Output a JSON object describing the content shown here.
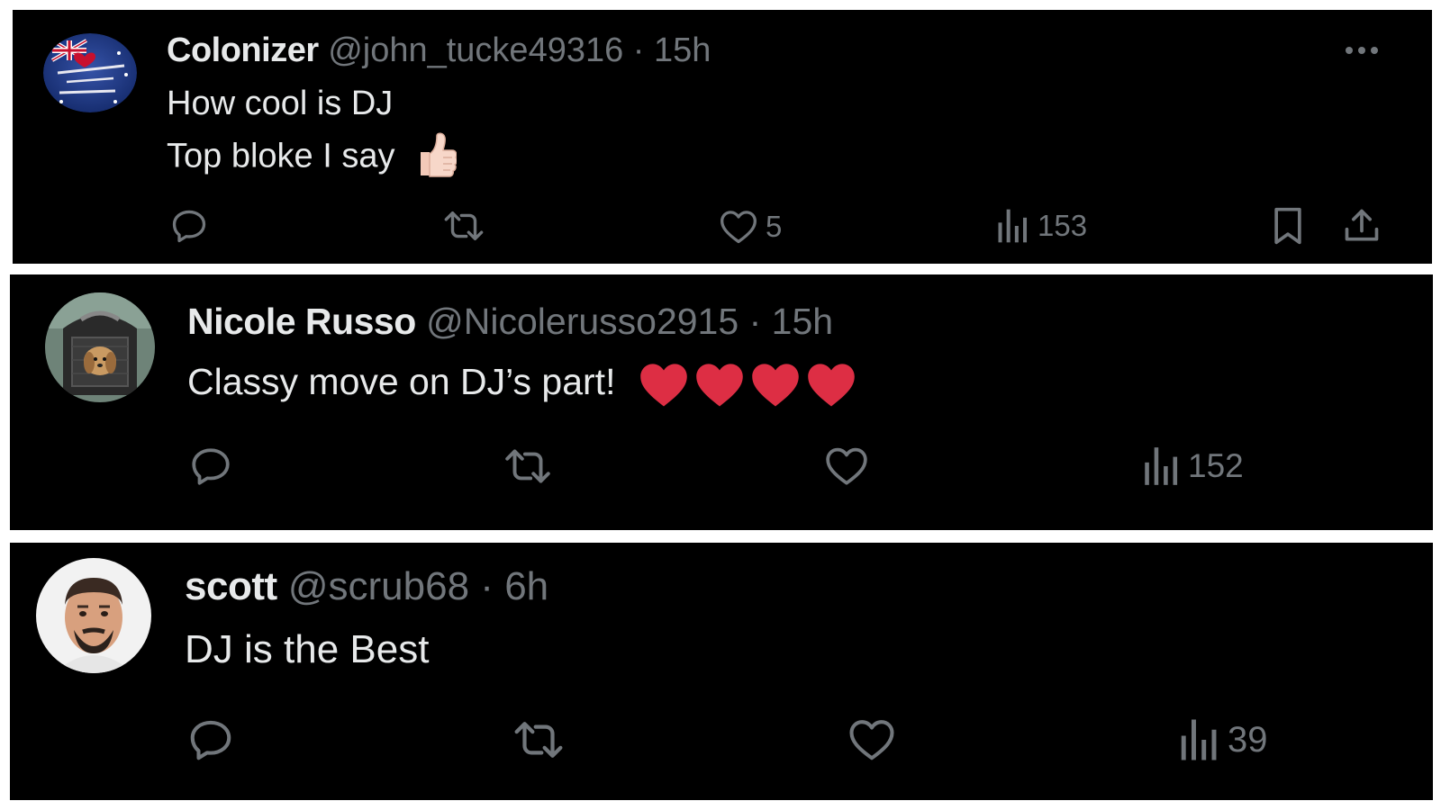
{
  "posts": [
    {
      "name": "Colonizer",
      "handle": "@john_tucke49316",
      "separator": "·",
      "time": "15h",
      "lines": [
        "How cool is DJ",
        "Top bloke I say"
      ],
      "emoji": "thumbs-up",
      "likes": "5",
      "views": "153",
      "avatar": {
        "colors": [
          "#1d3a8a",
          "#c8102e",
          "#ffffff"
        ],
        "lettering": "Happy Australia Day January 26th"
      }
    },
    {
      "name": "Nicole Russo",
      "handle": "@Nicolerusso2915",
      "separator": "·",
      "time": "15h",
      "text": "Classy move on DJ’s part!",
      "emoji": "red-heart x4",
      "views": "152"
    },
    {
      "name": "scott",
      "handle": "@scrub68",
      "separator": "·",
      "time": "6h",
      "text": "DJ is the Best",
      "views": "39"
    }
  ],
  "icons": {
    "reply": "speech-bubble",
    "repost": "repost-arrows",
    "like": "heart-outline",
    "views": "bar-chart",
    "bookmark": "bookmark",
    "share": "upload-arrow",
    "more": "three-dots"
  },
  "colors": {
    "background": "#000000",
    "name": "#e7e9ea",
    "muted": "#71767b",
    "heart_emoji": "#dd2e44"
  }
}
